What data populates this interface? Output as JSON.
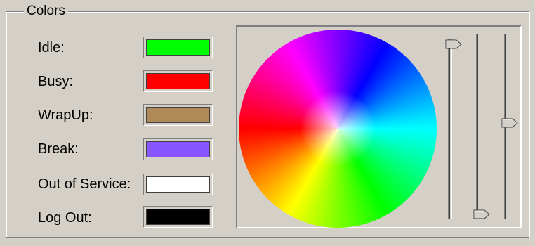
{
  "group": {
    "title": "Colors"
  },
  "rows": [
    {
      "label": "Idle:",
      "color": "#00ff00"
    },
    {
      "label": "Busy:",
      "color": "#ff0000"
    },
    {
      "label": "WrapUp:",
      "color": "#b08958"
    },
    {
      "label": "Break:",
      "color": "#8855ff"
    },
    {
      "label": "Out of Service:",
      "color": "#ffffff"
    },
    {
      "label": "Log Out:",
      "color": "#000000"
    }
  ],
  "picker": {
    "wheel": "hue-wheel",
    "sliders": [
      {
        "name": "slider-1",
        "level": 1.0
      },
      {
        "name": "slider-2",
        "level": 0.0
      },
      {
        "name": "slider-3",
        "level": 0.52
      }
    ]
  }
}
